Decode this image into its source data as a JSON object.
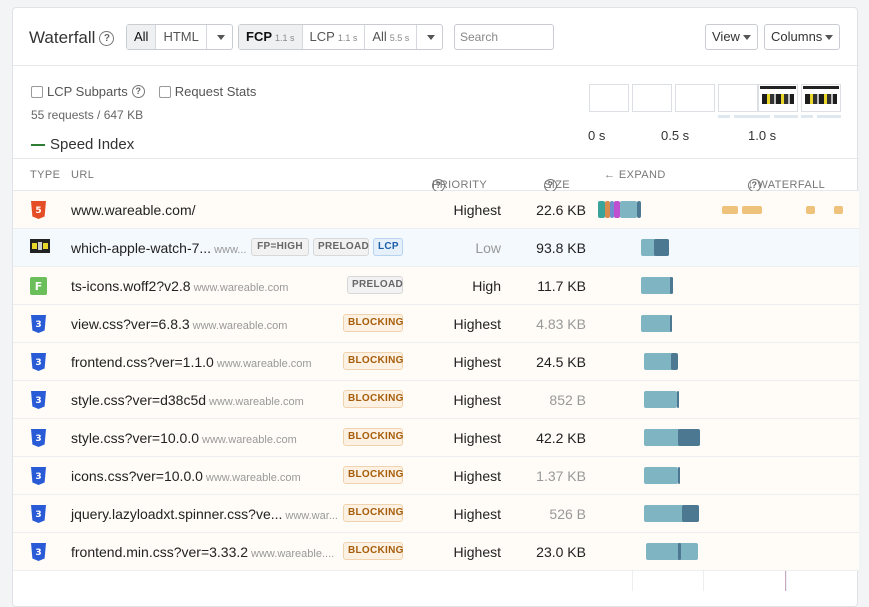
{
  "header": {
    "title": "Waterfall",
    "filter_type": {
      "options": [
        "All",
        "HTML"
      ],
      "selected": "All"
    },
    "filter_metric": {
      "items": [
        {
          "label": "FCP",
          "time": "1.1 s"
        },
        {
          "label": "LCP",
          "time": "1.1 s"
        },
        {
          "label": "All",
          "time": "5.5 s"
        }
      ],
      "selected": "FCP"
    },
    "search_placeholder": "Search",
    "view_label": "View",
    "columns_label": "Columns"
  },
  "options": {
    "lcp_subparts_label": "LCP Subparts",
    "request_stats_label": "Request Stats",
    "summary": "55 requests / 647 KB",
    "speed_index_label": "Speed Index"
  },
  "filmstrip": {
    "time_labels": [
      "0 s",
      "0.5 s",
      "1.0 s"
    ]
  },
  "columns": {
    "type": "TYPE",
    "url": "URL",
    "priority": "PRIORITY",
    "size": "SIZE",
    "expand": "← EXPAND",
    "waterfall": "↓ WATERFALL"
  },
  "requests": [
    {
      "type": "html",
      "url": "www.wareable.com/",
      "domain": "",
      "badges": [],
      "priority": "Highest",
      "size": "22.6 KB"
    },
    {
      "type": "image",
      "url": "which-apple-watch-7...",
      "domain": "www...",
      "badges": [
        "FP=HIGH",
        "PRELOAD",
        "LCP"
      ],
      "priority": "Low",
      "size": "93.8 KB"
    },
    {
      "type": "font",
      "url": "ts-icons.woff2?v2.8",
      "domain": "www.wareable.com",
      "badges": [
        "PRELOAD"
      ],
      "priority": "High",
      "size": "11.7 KB"
    },
    {
      "type": "css",
      "url": "view.css?ver=6.8.3",
      "domain": "www.wareable.com",
      "badges": [
        "BLOCKING"
      ],
      "priority": "Highest",
      "size": "4.83 KB"
    },
    {
      "type": "css",
      "url": "frontend.css?ver=1.1.0",
      "domain": "www.wareable.com",
      "badges": [
        "BLOCKING"
      ],
      "priority": "Highest",
      "size": "24.5 KB"
    },
    {
      "type": "css",
      "url": "style.css?ver=d38c5d",
      "domain": "www.wareable.com",
      "badges": [
        "BLOCKING"
      ],
      "priority": "Highest",
      "size": "852 B"
    },
    {
      "type": "css",
      "url": "style.css?ver=10.0.0",
      "domain": "www.wareable.com",
      "badges": [
        "BLOCKING"
      ],
      "priority": "Highest",
      "size": "42.2 KB"
    },
    {
      "type": "css",
      "url": "icons.css?ver=10.0.0",
      "domain": "www.wareable.com",
      "badges": [
        "BLOCKING"
      ],
      "priority": "Highest",
      "size": "1.37 KB"
    },
    {
      "type": "css",
      "url": "jquery.lazyloadxt.spinner.css?ve...",
      "domain": "www.war...",
      "badges": [
        "BLOCKING"
      ],
      "priority": "Highest",
      "size": "526 B"
    },
    {
      "type": "css",
      "url": "frontend.min.css?ver=3.33.2",
      "domain": "www.wareable....",
      "badges": [
        "BLOCKING"
      ],
      "priority": "Highest",
      "size": "23.0 KB"
    }
  ],
  "colors": {
    "html_icon": "#e44d26",
    "css_icon": "#2a5bd7",
    "font_icon": "#6bbf5a",
    "bar_main": "#7fb5c2",
    "bar_dark": "#4d7891",
    "speed_index": "#2e7d32"
  }
}
